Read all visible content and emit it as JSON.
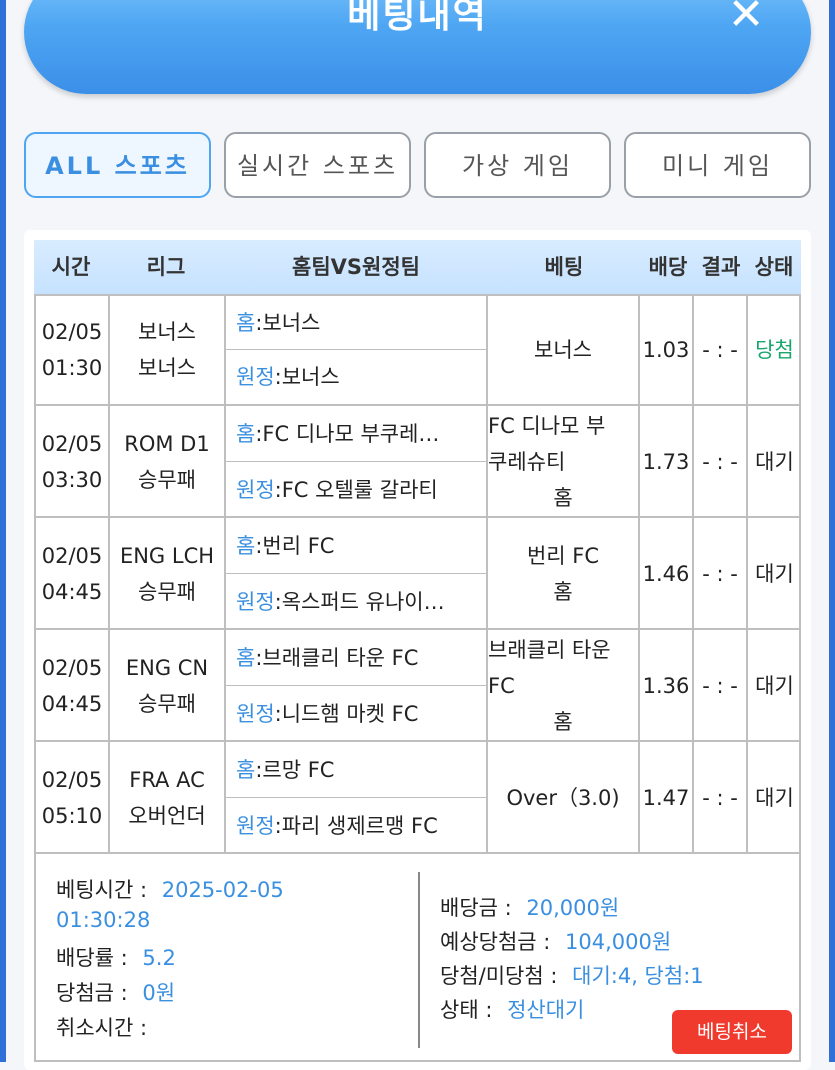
{
  "header": {
    "title": "베팅내역",
    "close_icon": "close-icon"
  },
  "tabs": [
    {
      "label": "ALL 스포츠",
      "active": true
    },
    {
      "label": "실시간 스포츠",
      "active": false
    },
    {
      "label": "가상 게임",
      "active": false
    },
    {
      "label": "미니 게임",
      "active": false
    }
  ],
  "table": {
    "headers": {
      "time": "시간",
      "league": "리그",
      "teams": "홈팀VS원정팀",
      "bet": "베팅",
      "odds": "배당",
      "result": "결과",
      "status": "상태"
    },
    "home_prefix": "홈",
    "away_prefix": "원정",
    "rows": [
      {
        "date": "02/05",
        "time": "01:30",
        "league": "보너스",
        "market": "보너스",
        "home": ":보너스",
        "away": ":보너스",
        "bet": [
          "보너스"
        ],
        "odds": "1.03",
        "result": "- : -",
        "status": "당첨"
      },
      {
        "date": "02/05",
        "time": "03:30",
        "league": "ROM D1",
        "market": "승무패",
        "home": ":FC 디나모 부쿠레…",
        "away": ":FC 오텔룰 갈라티",
        "bet": [
          "FC 디나모 부",
          "쿠레슈티",
          "홈"
        ],
        "odds": "1.73",
        "result": "- : -",
        "status": "대기"
      },
      {
        "date": "02/05",
        "time": "04:45",
        "league": "ENG LCH",
        "market": "승무패",
        "home": ":번리 FC",
        "away": ":옥스퍼드 유나이…",
        "bet": [
          "번리 FC",
          "홈"
        ],
        "odds": "1.46",
        "result": "- : -",
        "status": "대기"
      },
      {
        "date": "02/05",
        "time": "04:45",
        "league": "ENG CN",
        "market": "승무패",
        "home": ":브래클리 타운 FC",
        "away": ":니드햄 마켓 FC",
        "bet": [
          "브래클리 타운",
          "FC",
          "홈"
        ],
        "odds": "1.36",
        "result": "- : -",
        "status": "대기"
      },
      {
        "date": "02/05",
        "time": "05:10",
        "league": "FRA AC",
        "market": "오버언더",
        "home": ":르망 FC",
        "away": ":파리 생제르맹 FC",
        "bet": [
          "Over（3.0)"
        ],
        "odds": "1.47",
        "result": "- : -",
        "status": "대기"
      }
    ]
  },
  "summary": {
    "bet_time_label": "베팅시간 :",
    "bet_time_date": "2025-02-05",
    "bet_time_clock": "01:30:28",
    "odds_rate_label": "배당률 :",
    "odds_rate_value": "5.2",
    "win_amount_label": "당첨금 :",
    "win_amount_value": "0원",
    "cancel_time_label": "취소시간 :",
    "stake_label": "배당금 :",
    "stake_value": "20,000원",
    "expected_label": "예상당첨금 :",
    "expected_value": "104,000원",
    "win_lose_label": "당첨/미당첨 :",
    "win_lose_value": "대기:4, 당첨:1",
    "status_label": "상태 :",
    "status_value": "정산대기",
    "cancel_button": "베팅취소"
  },
  "colors": {
    "accent": "#3a8fe0",
    "header": "#4ea6f3",
    "win": "#19a66c",
    "cancel": "#f03a2e"
  }
}
